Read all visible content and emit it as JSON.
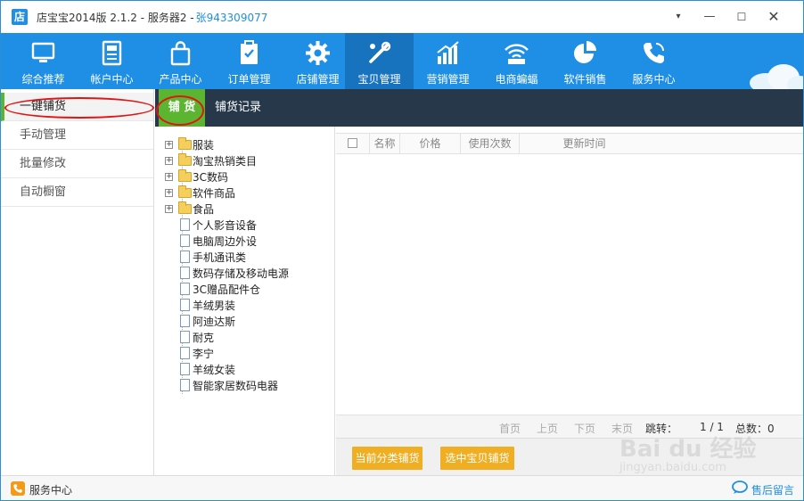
{
  "window": {
    "logo_char": "店",
    "title": "店宝宝2014版 2.1.2 - 服务器2 -",
    "account": "张943309077",
    "controls": {
      "menu": "▾",
      "minimize": "—",
      "maximize": "☐",
      "close": "✕"
    }
  },
  "nav": {
    "items": [
      {
        "label": "综合推荐",
        "icon": "monitor-icon"
      },
      {
        "label": "帐户中心",
        "icon": "id-card-icon"
      },
      {
        "label": "产品中心",
        "icon": "shopping-bag-icon"
      },
      {
        "label": "订单管理",
        "icon": "clipboard-icon"
      },
      {
        "label": "店铺管理",
        "icon": "gear-icon"
      },
      {
        "label": "宝贝管理",
        "icon": "tools-icon",
        "active": true
      },
      {
        "label": "营销管理",
        "icon": "bar-chart-icon"
      },
      {
        "label": "电商蝙蝠",
        "icon": "wifi-icon"
      },
      {
        "label": "软件销售",
        "icon": "pie-chart-icon"
      },
      {
        "label": "服务中心",
        "icon": "phone-icon"
      }
    ]
  },
  "sidebar": {
    "items": [
      {
        "label": "一键铺货",
        "active": true
      },
      {
        "label": "手动管理"
      },
      {
        "label": "批量修改"
      },
      {
        "label": "自动橱窗"
      }
    ]
  },
  "subtabs": {
    "active": "铺 货",
    "second": "铺货记录"
  },
  "tree": {
    "folders": [
      "服装",
      "淘宝热销类目",
      "3C数码",
      "软件商品",
      "食品"
    ],
    "expand_glyph": "+",
    "leaves": [
      "个人影音设备",
      "电脑周边外设",
      "手机通讯类",
      "数码存储及移动电源",
      "3C赠品配件仓",
      "羊绒男装",
      "阿迪达斯",
      "耐克",
      "李宁",
      "羊绒女装",
      "智能家居数码电器"
    ]
  },
  "table": {
    "headers": {
      "name": "名称",
      "price": "价格",
      "uses": "使用次数",
      "updated": "更新时间"
    }
  },
  "pager": {
    "first": "首页",
    "prev": "上页",
    "next": "下页",
    "last": "末页",
    "jump": "跳转：",
    "page_info": "1 / 1",
    "total": "总数：0"
  },
  "actions": {
    "by_category": "当前分类铺货",
    "selected": "选中宝贝铺货"
  },
  "statusbar": {
    "service": "服务中心",
    "feedback": "售后留言"
  },
  "watermark": {
    "brand": "Bai du 经验",
    "url": "jingyan.baidu.com"
  },
  "colors": {
    "nav_bg": "#1f8fe5",
    "nav_active": "#1773be",
    "accent_green": "#5cb531",
    "subbar_bg": "#26384a",
    "button_orange": "#f0ae23",
    "highlight_red": "#e01515"
  }
}
